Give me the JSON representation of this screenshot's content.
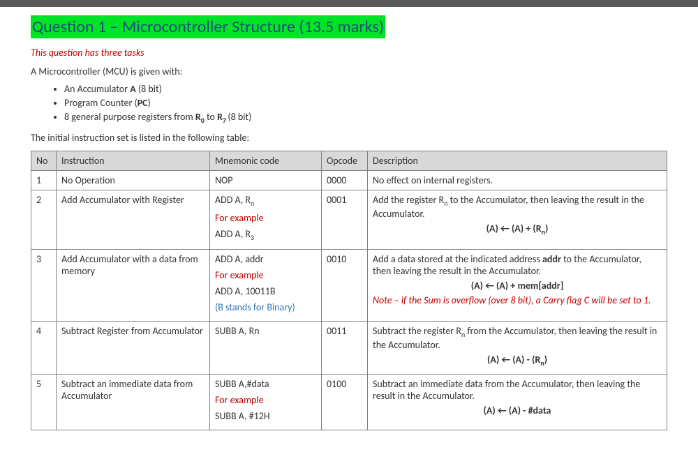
{
  "title": "Question 1 – Microcontroller Structure (13.5 marks)",
  "subtitle": "This question has three tasks",
  "intro": "A Microcontroller (MCU) is given with:",
  "bullets": {
    "b1_pre": "An Accumulator ",
    "b1_bold": "A",
    "b1_post": " (8 bit)",
    "b2_pre": "Program Counter (",
    "b2_bold": "PC",
    "b2_post": ")",
    "b3_pre": "8 general purpose registers from ",
    "b3_r0": "R",
    "b3_r0s": "0",
    "b3_mid": " to ",
    "b3_r7": "R",
    "b3_r7s": "7 ",
    "b3_post": "(8 bit)"
  },
  "tableIntro": "The initial instruction set is listed in the following table:",
  "headers": {
    "no": "No",
    "instr": "Instruction",
    "mne": "Mnemonic code",
    "op": "Opcode",
    "desc": "Description"
  },
  "rows": {
    "r1": {
      "no": "1",
      "instr": "No Operation",
      "mne": "NOP",
      "op": "0000",
      "desc": "No effect on internal registers."
    },
    "r2": {
      "no": "2",
      "instr": "Add Accumulator with Register",
      "mne1": "ADD A, R",
      "mne1s": "n",
      "ex_label": "For example",
      "mne2": "ADD A, R",
      "mne2s": "3",
      "op": "0001",
      "desc1a": "Add the register R",
      "desc1s": "n",
      "desc1b": " to the Accumulator, then leaving the result in the Accumulator.",
      "formula": "(A) ← (A) + (R",
      "formula_s": "n",
      "formula_end": ")"
    },
    "r3": {
      "no": "3",
      "instr": "Add Accumulator with a data from memory",
      "mne1": "ADD A, addr",
      "ex_label": "For example",
      "mne2": "ADD A, 10011B",
      "bnote": "(B stands for Binary)",
      "op": "0010",
      "desc1a": "Add a data stored at the indicated address ",
      "desc1bold": "addr",
      "desc1b": " to the Accumulator, then leaving the result in the Accumulator.",
      "formula": "(A) ← (A) + mem[addr]",
      "note": "Note – if the Sum is overflow (over 8 bit), a Carry flag C will be set to 1."
    },
    "r4": {
      "no": "4",
      "instr": "Subtract Register from Accumulator",
      "mne": "SUBB A, Rn",
      "op": "0011",
      "desc1a": "Subtract the register R",
      "desc1s": "n",
      "desc1b": " from the Accumulator, then leaving the result in the Accumulator.",
      "formula": "(A) ← (A) - (R",
      "formula_s": "n",
      "formula_end": ")"
    },
    "r5": {
      "no": "5",
      "instr": "Subtract an immediate data from Accumulator",
      "mne1": "SUBB A,#data",
      "ex_label": "For example",
      "mne2": "SUBB A, #12H",
      "op": "0100",
      "desc1": "Subtract an immediate data from the Accumulator, then leaving the result in the Accumulator.",
      "formula": "(A) ← (A) - #data"
    }
  }
}
